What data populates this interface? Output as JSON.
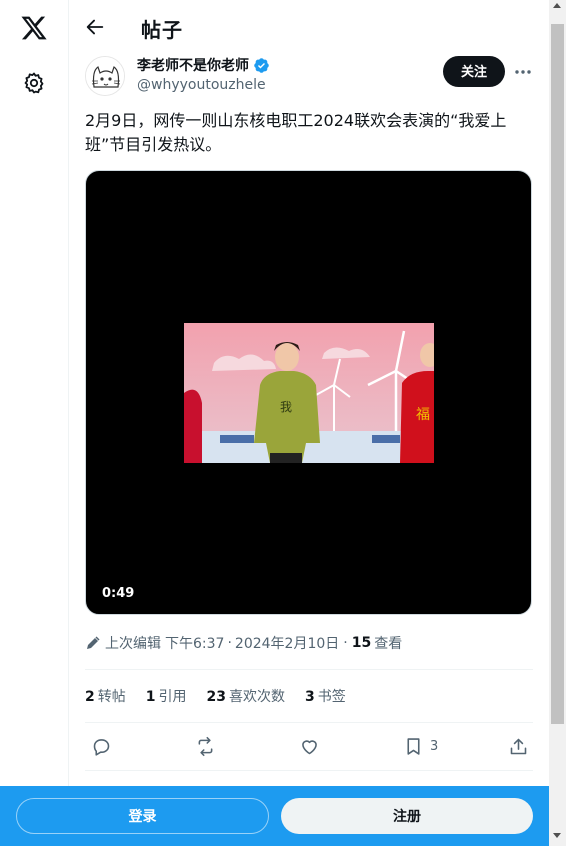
{
  "header": {
    "title": "帖子"
  },
  "author": {
    "name": "李老师不是你老师",
    "handle": "@whyyoutouzhele",
    "follow_label": "关注"
  },
  "post": {
    "text": "2月9日，网传一则山东核电职工2024联欢会表演的“我爱上班”节目引发热议。",
    "video_duration": "0:49"
  },
  "meta": {
    "edited_label": "上次编辑",
    "time": "下午6:37",
    "date": "2024年2月10日",
    "views_count": "15",
    "views_label": "查看"
  },
  "stats": {
    "reposts_count": "2",
    "reposts_label": "转帖",
    "quotes_count": "1",
    "quotes_label": "引用",
    "likes_count": "23",
    "likes_label": "喜欢次数",
    "bookmarks_count": "3",
    "bookmarks_label": "书签"
  },
  "actions": {
    "bookmark_count": "3"
  },
  "bottom_bar": {
    "login_label": "登录",
    "signup_label": "注册"
  },
  "colors": {
    "brand": "#1d9bf0",
    "text": "#0f1419",
    "muted": "#536471"
  },
  "icons": [
    "x-logo-icon",
    "gear-icon",
    "back-arrow-icon",
    "verified-badge-icon",
    "more-icon",
    "pencil-icon",
    "reply-icon",
    "retweet-icon",
    "heart-icon",
    "bookmark-icon",
    "share-icon"
  ]
}
